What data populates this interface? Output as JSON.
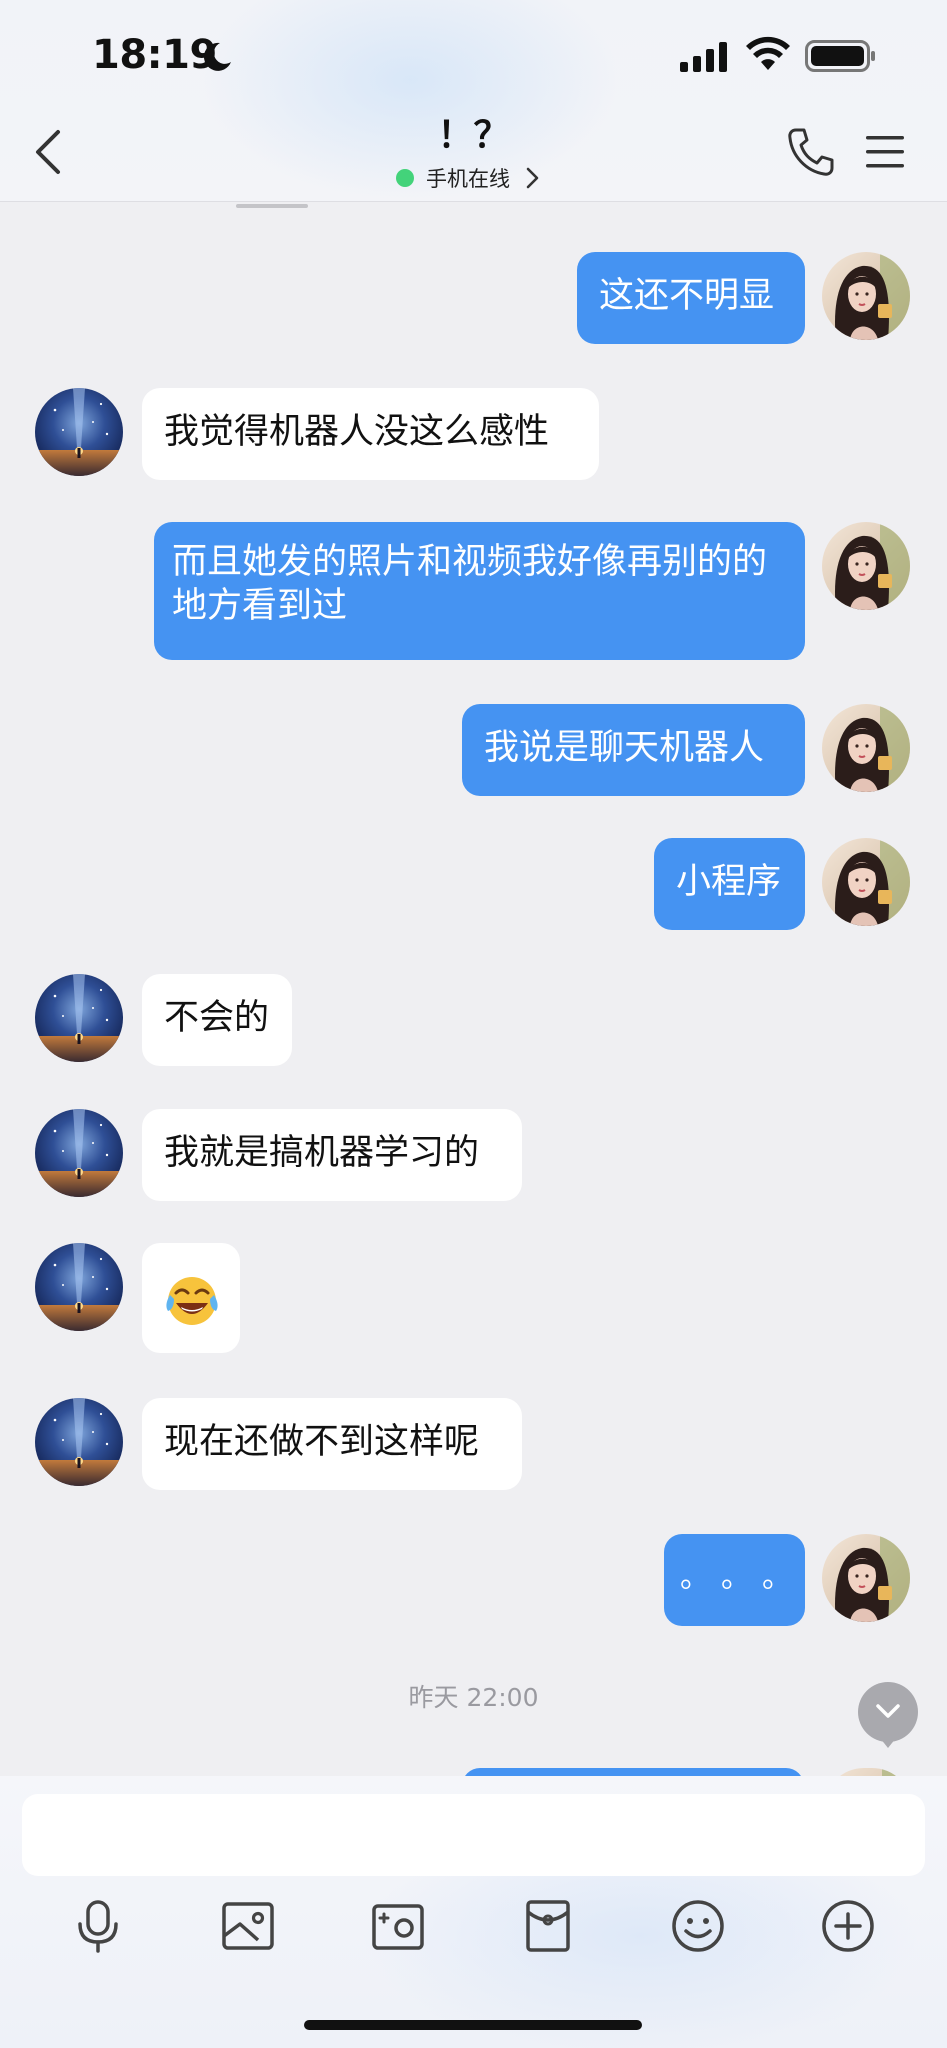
{
  "status_bar": {
    "time": "18:19"
  },
  "header": {
    "title": "！？",
    "status": "手机在线"
  },
  "messages": [
    {
      "side": "out",
      "text": "这还不明显"
    },
    {
      "side": "in",
      "text": "我觉得机器人没这么感性"
    },
    {
      "side": "out",
      "text": "而且她发的照片和视频我好像再别的的地方看到过"
    },
    {
      "side": "out",
      "text": "我说是聊天机器人"
    },
    {
      "side": "out",
      "text": "小程序"
    },
    {
      "side": "in",
      "text": "不会的"
    },
    {
      "side": "in",
      "text": "我就是搞机器学习的"
    },
    {
      "side": "in",
      "text": "😂",
      "emoji": "tears-of-joy"
    },
    {
      "side": "in",
      "text": "现在还做不到这样呢"
    },
    {
      "side": "out",
      "text": "。。。"
    }
  ],
  "timestamp": "昨天 22:00",
  "composer": {
    "input_value": "",
    "tools": [
      "microphone-icon",
      "image-icon",
      "camera-icon",
      "red-packet-icon",
      "emoji-icon",
      "plus-icon"
    ]
  },
  "colors": {
    "outgoing_bubble": "#4593f2",
    "incoming_bubble": "#ffffff",
    "online_dot": "#43d37a",
    "chat_background": "#efeff2"
  }
}
